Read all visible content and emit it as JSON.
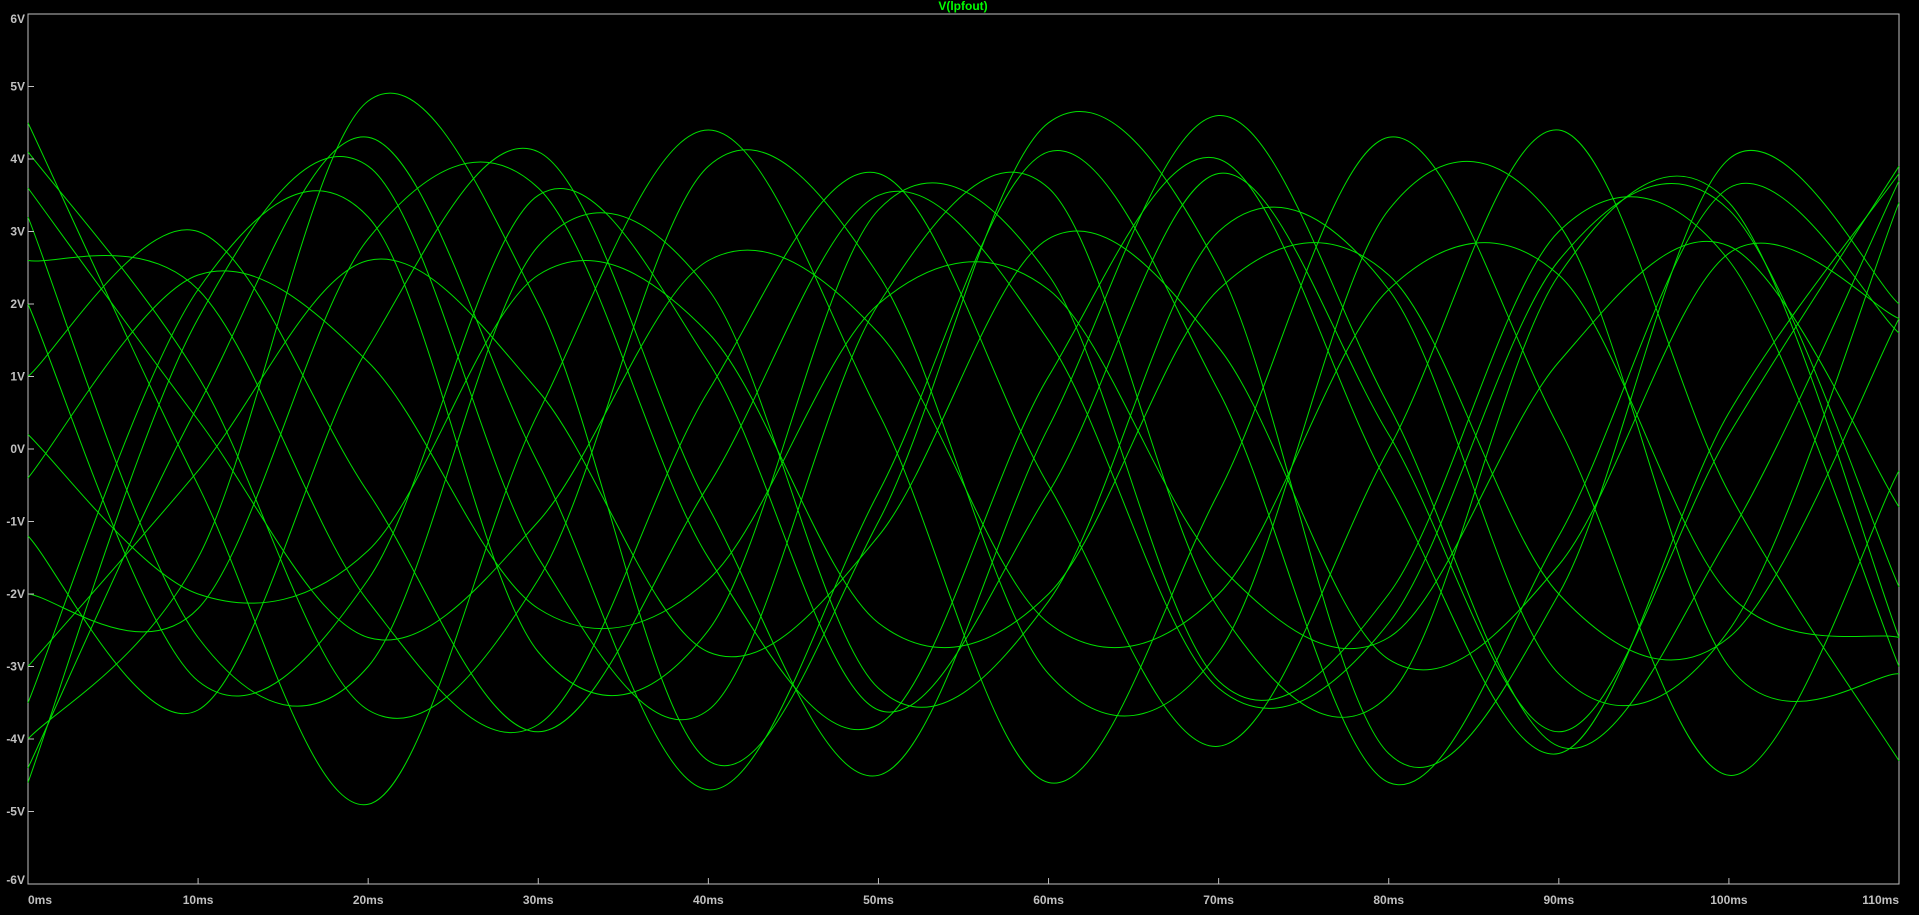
{
  "trace_label": "V(lpfout)",
  "colors": {
    "background": "#000000",
    "trace": "#00e000",
    "axis": "#c0c0c0",
    "title": "#00ff00"
  },
  "chart_data": {
    "type": "line",
    "title": "V(lpfout)",
    "xlabel": "",
    "ylabel": "",
    "xlim": [
      0,
      110
    ],
    "ylim": [
      -6,
      6
    ],
    "x_ticks": [
      "0ms",
      "10ms",
      "20ms",
      "30ms",
      "40ms",
      "50ms",
      "60ms",
      "70ms",
      "80ms",
      "90ms",
      "100ms",
      "110ms"
    ],
    "y_ticks": [
      "6V",
      "5V",
      "4V",
      "3V",
      "2V",
      "1V",
      "0V",
      "-1V",
      "-2V",
      "-3V",
      "-4V",
      "-5V",
      "-6V"
    ],
    "x_unit": "ms",
    "y_unit": "V",
    "grid": false,
    "series": [
      {
        "x": [
          0,
          10,
          20,
          30,
          40,
          50,
          60,
          70,
          80,
          90,
          100,
          110
        ],
        "y": [
          -4.0,
          -1.5,
          4.8,
          2.0,
          -4.3,
          -1.0,
          4.5,
          2.5,
          -4.2,
          -2.0,
          4.0,
          2.0
        ]
      },
      {
        "x": [
          0,
          10,
          20,
          30,
          40,
          50,
          60,
          70,
          80,
          90,
          100,
          110
        ],
        "y": [
          4.5,
          -0.5,
          -4.9,
          0.5,
          4.4,
          0.5,
          -4.6,
          -0.6,
          4.3,
          0.3,
          -4.5,
          -0.3
        ]
      },
      {
        "x": [
          0,
          10,
          20,
          30,
          40,
          50,
          60,
          70,
          80,
          90,
          100,
          110
        ],
        "y": [
          -3.5,
          2.2,
          3.2,
          -2.8,
          -2.5,
          3.3,
          2.4,
          -3.2,
          -2.0,
          3.0,
          2.6,
          -3.0
        ]
      },
      {
        "x": [
          0,
          10,
          20,
          30,
          40,
          50,
          60,
          70,
          80,
          90,
          100,
          110
        ],
        "y": [
          3.2,
          -2.6,
          -3.0,
          2.8,
          2.2,
          -3.3,
          -2.1,
          3.0,
          2.2,
          -3.1,
          -2.5,
          3.4
        ]
      },
      {
        "x": [
          0,
          10,
          20,
          30,
          40,
          50,
          60,
          70,
          80,
          90,
          100,
          110
        ],
        "y": [
          -2.0,
          -2.2,
          2.9,
          3.6,
          -1.5,
          -3.8,
          1.0,
          4.0,
          -0.5,
          -4.2,
          0.5,
          3.8
        ]
      },
      {
        "x": [
          0,
          10,
          20,
          30,
          40,
          50,
          60,
          70,
          80,
          90,
          100,
          110
        ],
        "y": [
          2.6,
          2.2,
          -2.1,
          -3.8,
          0.8,
          3.8,
          -0.5,
          -4.1,
          0.0,
          4.4,
          -0.6,
          -4.3
        ]
      },
      {
        "x": [
          0,
          10,
          20,
          30,
          40,
          50,
          60,
          70,
          80,
          90,
          100,
          110
        ],
        "y": [
          -4.4,
          0.6,
          4.3,
          -0.2,
          -4.7,
          -0.6,
          4.1,
          0.8,
          -4.6,
          -1.2,
          3.6,
          1.6
        ]
      },
      {
        "x": [
          0,
          10,
          20,
          30,
          40,
          50,
          60,
          70,
          80,
          90,
          100,
          110
        ],
        "y": [
          4.1,
          1.0,
          -3.6,
          -1.8,
          3.9,
          2.4,
          -3.1,
          -2.8,
          3.3,
          3.1,
          -3.0,
          -3.1
        ]
      },
      {
        "x": [
          0,
          10,
          20,
          30,
          40,
          50,
          60,
          70,
          80,
          90,
          100,
          110
        ],
        "y": [
          -1.2,
          -3.6,
          1.4,
          4.1,
          -0.8,
          -4.5,
          0.3,
          4.6,
          0.6,
          -4.1,
          -1.2,
          3.7
        ]
      },
      {
        "x": [
          0,
          10,
          20,
          30,
          40,
          50,
          60,
          70,
          80,
          90,
          100,
          110
        ],
        "y": [
          1.0,
          3.0,
          -0.6,
          -3.9,
          -0.5,
          3.5,
          1.5,
          -3.3,
          -2.4,
          2.6,
          3.3,
          -1.9
        ]
      },
      {
        "x": [
          0,
          10,
          20,
          30,
          40,
          50,
          60,
          70,
          80,
          90,
          100,
          110
        ],
        "y": [
          -3.0,
          -0.3,
          2.6,
          0.8,
          -2.8,
          -1.2,
          2.9,
          1.4,
          -2.9,
          -1.6,
          2.7,
          1.8
        ]
      },
      {
        "x": [
          0,
          10,
          20,
          30,
          40,
          50,
          60,
          70,
          80,
          90,
          100,
          110
        ],
        "y": [
          3.6,
          0.4,
          -2.6,
          -1.0,
          2.6,
          1.6,
          -2.4,
          -2.0,
          2.2,
          2.4,
          -2.0,
          -2.6
        ]
      },
      {
        "x": [
          0,
          10,
          20,
          30,
          40,
          50,
          60,
          70,
          80,
          90,
          100,
          110
        ],
        "y": [
          -4.6,
          1.8,
          3.9,
          -1.5,
          -3.6,
          2.0,
          3.6,
          -2.2,
          -3.4,
          2.4,
          3.4,
          -2.6
        ]
      },
      {
        "x": [
          0,
          10,
          20,
          30,
          40,
          50,
          60,
          70,
          80,
          90,
          100,
          110
        ],
        "y": [
          2.0,
          -3.2,
          -1.8,
          3.5,
          1.2,
          -3.6,
          -0.6,
          3.8,
          0.2,
          -3.9,
          0.2,
          3.9
        ]
      },
      {
        "x": [
          0,
          10,
          20,
          30,
          40,
          50,
          60,
          70,
          80,
          90,
          100,
          110
        ],
        "y": [
          -0.4,
          2.4,
          1.2,
          -2.2,
          -1.8,
          2.0,
          2.2,
          -1.6,
          -2.6,
          1.2,
          2.8,
          -0.8
        ]
      },
      {
        "x": [
          0,
          10,
          20,
          30,
          40,
          50,
          60,
          70,
          80,
          90,
          100,
          110
        ],
        "y": [
          0.2,
          -2.0,
          -1.4,
          2.4,
          1.6,
          -2.4,
          -2.0,
          2.2,
          2.4,
          -2.0,
          -2.6,
          1.8
        ]
      }
    ]
  }
}
